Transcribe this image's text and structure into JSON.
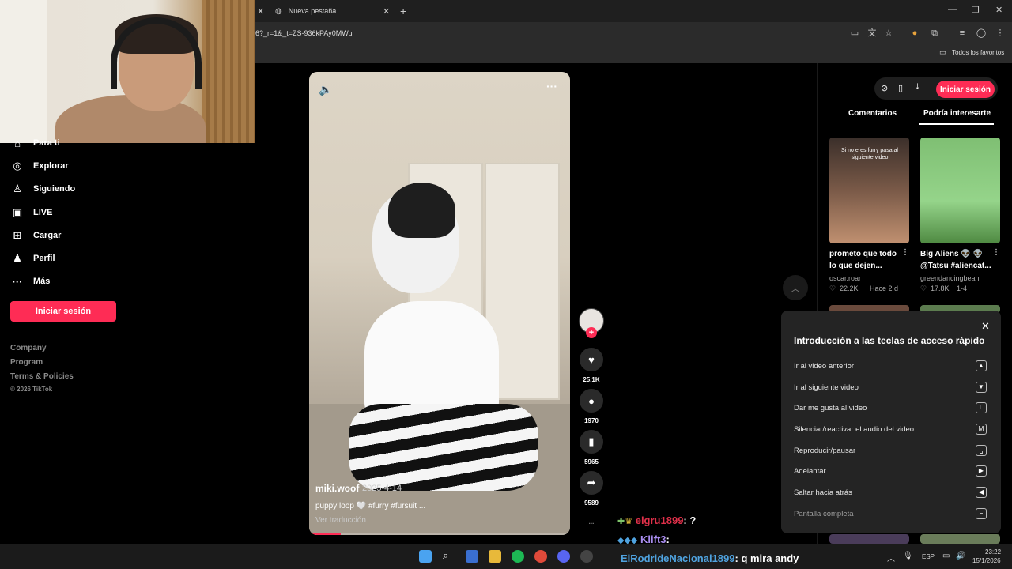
{
  "browser": {
    "active_tab_title": "Nueva pestaña",
    "url": "6?_r=1&_t=ZS-936kPAy0MWu",
    "bookmarks_folder": "Todos los favoritos"
  },
  "sidebar": {
    "items": [
      {
        "label": "Para ti",
        "icon": "home-icon"
      },
      {
        "label": "Explorar",
        "icon": "compass-icon"
      },
      {
        "label": "Siguiendo",
        "icon": "following-icon"
      },
      {
        "label": "LIVE",
        "icon": "live-icon"
      },
      {
        "label": "Cargar",
        "icon": "upload-icon"
      },
      {
        "label": "Perfil",
        "icon": "profile-icon"
      },
      {
        "label": "Más",
        "icon": "more-icon"
      }
    ],
    "login_label": "Iniciar sesión",
    "footer": [
      "Company",
      "Program",
      "Terms & Policies"
    ],
    "copyright": "© 2026 TikTok"
  },
  "video": {
    "author": "miki.woof",
    "date": "2025-4-14",
    "caption": "puppy loop 🤍      #furry #fursuit ...",
    "translate_label": "Ver traducción",
    "progress_percent": 12
  },
  "actions": {
    "likes": "25.1K",
    "comments": "1970",
    "saves": "5965",
    "shares": "9589",
    "more": "..."
  },
  "right_panel": {
    "login_label": "Iniciar sesión",
    "tabs": [
      "Comentarios",
      "Podría interesarte"
    ],
    "active_tab": "Podría interesarte",
    "recommendations": [
      {
        "title": "prometo que todo lo que dejen...",
        "author": "oscar.roar",
        "likes": "22.2K",
        "time": "Hace 2 d",
        "thumb_text": "Si no eres furry pasa al siguiente video"
      },
      {
        "title": "Big Aliens 👽 👽 @Tatsu #aliencat...",
        "author": "greendancingbean",
        "likes": "17.8K",
        "time": "1-4"
      }
    ]
  },
  "shortcuts": {
    "title": "Introducción a las teclas de acceso rápido",
    "rows": [
      {
        "label": "Ir al video anterior",
        "key": "▲"
      },
      {
        "label": "Ir al siguiente video",
        "key": "▼"
      },
      {
        "label": "Dar me gusta al video",
        "key": "L"
      },
      {
        "label": "Silenciar/reactivar el audio del video",
        "key": "M"
      },
      {
        "label": "Reproducir/pausar",
        "key": "␣"
      },
      {
        "label": "Adelantar",
        "key": "▶"
      },
      {
        "label": "Saltar hacia atrás",
        "key": "◀"
      },
      {
        "label": "Pantalla completa",
        "key": "F"
      }
    ]
  },
  "chat": [
    {
      "user": "elgru1899",
      "message": ": ?",
      "color": "#e0304a"
    },
    {
      "user": "Klift3",
      "message": ":",
      "color": "#a98df0"
    },
    {
      "user": "ElRodrideNacional1899",
      "message": ": q mira andy",
      "color": "#4fa3e0"
    }
  ],
  "taskbar": {
    "language": "ESP",
    "time": "23:22",
    "date": "15/1/2026"
  },
  "colors": {
    "accent": "#fe2c55",
    "background": "#000000"
  }
}
